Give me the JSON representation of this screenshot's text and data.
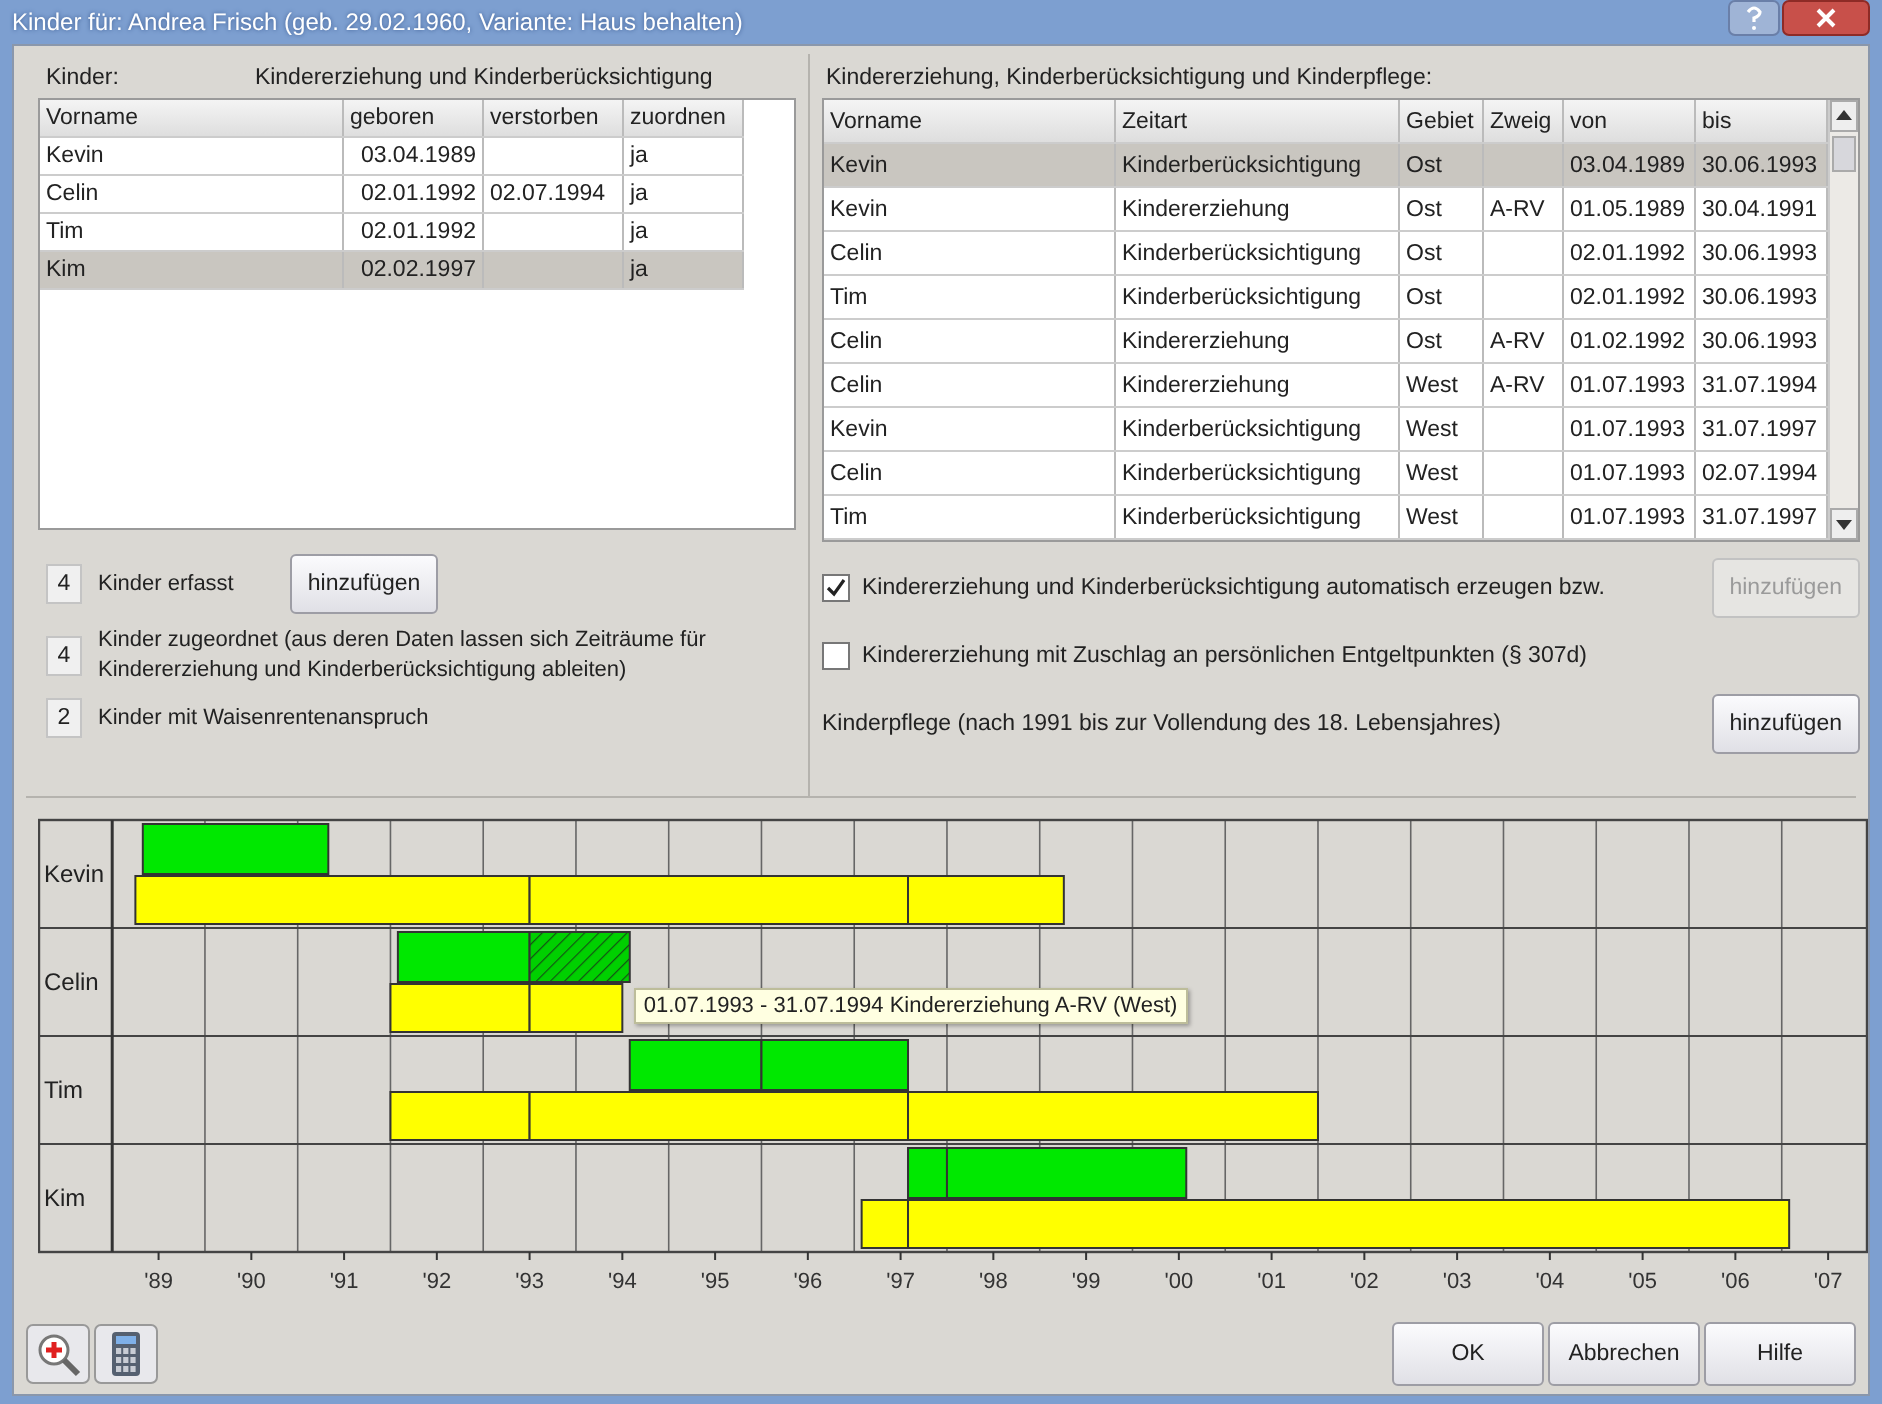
{
  "window": {
    "title": "Kinder für: Andrea Frisch (geb. 29.02.1960, Variante: Haus behalten)"
  },
  "children_panel": {
    "label": "Kinder:",
    "heading": "Kindererziehung und Kinderberücksichtigung",
    "columns": [
      "Vorname",
      "geboren",
      "verstorben",
      "zuordnen"
    ],
    "rows": [
      {
        "cells": [
          "Kevin",
          "03.04.1989",
          "",
          "ja"
        ],
        "selected": false
      },
      {
        "cells": [
          "Celin",
          "02.01.1992",
          "02.07.1994",
          "ja"
        ],
        "selected": false
      },
      {
        "cells": [
          "Tim",
          "02.01.1992",
          "",
          "ja"
        ],
        "selected": false
      },
      {
        "cells": [
          "Kim",
          "02.02.1997",
          "",
          "ja"
        ],
        "selected": true
      }
    ]
  },
  "counts": [
    {
      "value": "4",
      "text": "Kinder erfasst",
      "button": "hinzufügen"
    },
    {
      "value": "4",
      "text": "Kinder zugeordnet (aus deren Daten lassen sich Zeiträume für Kindererziehung und Kinderberücksichtigung ableiten)"
    },
    {
      "value": "2",
      "text": "Kinder mit Waisenrentenanspruch"
    }
  ],
  "periods_panel": {
    "heading": "Kindererziehung, Kinderberücksichtigung und Kinderpflege:",
    "columns": [
      "Vorname",
      "Zeitart",
      "Gebiet",
      "Zweig",
      "von",
      "bis"
    ],
    "rows": [
      {
        "cells": [
          "Kevin",
          "Kinderberücksichtigung",
          "Ost",
          "",
          "03.04.1989",
          "30.06.1993"
        ],
        "selected": true
      },
      {
        "cells": [
          "Kevin",
          "Kindererziehung",
          "Ost",
          "A-RV",
          "01.05.1989",
          "30.04.1991"
        ],
        "selected": false
      },
      {
        "cells": [
          "Celin",
          "Kinderberücksichtigung",
          "Ost",
          "",
          "02.01.1992",
          "30.06.1993"
        ],
        "selected": false
      },
      {
        "cells": [
          "Tim",
          "Kinderberücksichtigung",
          "Ost",
          "",
          "02.01.1992",
          "30.06.1993"
        ],
        "selected": false
      },
      {
        "cells": [
          "Celin",
          "Kindererziehung",
          "Ost",
          "A-RV",
          "01.02.1992",
          "30.06.1993"
        ],
        "selected": false
      },
      {
        "cells": [
          "Celin",
          "Kindererziehung",
          "West",
          "A-RV",
          "01.07.1993",
          "31.07.1994"
        ],
        "selected": false
      },
      {
        "cells": [
          "Kevin",
          "Kinderberücksichtigung",
          "West",
          "",
          "01.07.1993",
          "31.07.1997"
        ],
        "selected": false
      },
      {
        "cells": [
          "Celin",
          "Kinderberücksichtigung",
          "West",
          "",
          "01.07.1993",
          "02.07.1994"
        ],
        "selected": false
      },
      {
        "cells": [
          "Tim",
          "Kinderberücksichtigung",
          "West",
          "",
          "01.07.1993",
          "31.07.1997"
        ],
        "selected": false
      }
    ]
  },
  "options": [
    {
      "kind": "checkbox",
      "label": "Kindererziehung und Kinderberücksichtigung automatisch erzeugen bzw.",
      "checked": true,
      "button": "hinzufügen",
      "button_disabled": true
    },
    {
      "kind": "checkbox",
      "label": "Kindererziehung mit Zuschlag an persönlichen Entgeltpunkten (§ 307d)",
      "checked": false
    },
    {
      "kind": "text",
      "label": "Kinderpflege (nach 1991 bis zur Vollendung des 18. Lebensjahres)",
      "button": "hinzufügen",
      "button_disabled": false
    }
  ],
  "timeline": {
    "row_labels": [
      "Kevin",
      "Celin",
      "Tim",
      "Kim"
    ],
    "axis_labels": [
      "'89",
      "'90",
      "'91",
      "'92",
      "'93",
      "'94",
      "'95",
      "'96",
      "'97",
      "'98",
      "'99",
      "'00",
      "'01",
      "'02",
      "'03",
      "'04",
      "'05",
      "'06",
      "'07"
    ],
    "tooltip": "01.07.1993 - 31.07.1994 Kindererziehung A-RV (West)"
  },
  "footer_buttons": [
    "OK",
    "Abbrechen",
    "Hilfe"
  ]
}
